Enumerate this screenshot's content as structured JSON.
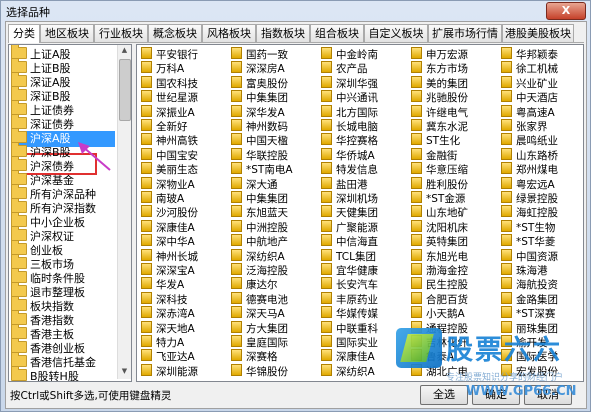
{
  "window": {
    "title": "选择品种",
    "close_label": "X"
  },
  "tabs": [
    "分类",
    "地区板块",
    "行业板块",
    "概念板块",
    "风格板块",
    "指数板块",
    "组合板块",
    "自定义板块",
    "扩展市场行情",
    "港股美股板块"
  ],
  "tree": [
    "上证A股",
    "上证B股",
    "深证A股",
    "深证B股",
    "上证债券",
    "深证债券",
    "沪深A股",
    "沪深B股",
    "沪深债券",
    "沪深基金",
    "所有沪深品种",
    "所有沪深指数",
    "中小企业板",
    "沪深权证",
    "创业板",
    "三板市场",
    "临时条件股",
    "退市整理板",
    "板块指数",
    "香港指数",
    "香港主板",
    "香港创业板",
    "香港信托基金",
    "B股转H股"
  ],
  "stocks": [
    [
      "平安银行",
      "万科A",
      "国农科技",
      "世纪星源",
      "深振业A",
      "全新好",
      "神州高铁",
      "中国宝安",
      "美丽生态",
      "深物业A",
      "南玻A",
      "沙河股份",
      "深康佳A",
      "深中华A",
      "神州长城",
      "深深宝A",
      "华发A",
      "深科技",
      "深赤湾A",
      "深天地A",
      "特力A",
      "飞亚达A",
      "深圳能源"
    ],
    [
      "国药一致",
      "深深房A",
      "富奥股份",
      "中集集团",
      "深华发A",
      "神州数码",
      "中国天楹",
      "华联控股",
      "*ST南电A",
      "深大通",
      "中集集团",
      "东旭蓝天",
      "中洲控股",
      "中航地产",
      "深纺织A",
      "泛海控股",
      "康达尔",
      "德赛电池",
      "深天马A",
      "方大集团",
      "皇庭国际",
      "深赛格",
      "华锦股份"
    ],
    [
      "中金岭南",
      "农产品",
      "深圳华强",
      "中兴通讯",
      "北方国际",
      "长城电脑",
      "华控赛格",
      "华侨城A",
      "特发信息",
      "盐田港",
      "深圳机场",
      "天健集团",
      "广聚能源",
      "中信海直",
      "TCL集团",
      "宜华健康",
      "长安汽车",
      "丰原药业",
      "华媒传媒",
      "中联重科",
      "国际实业",
      "深康佳A",
      "深纺织A"
    ],
    [
      "申万宏源",
      "东方市场",
      "美的集团",
      "兆驰股份",
      "许继电气",
      "冀东水泥",
      "ST生化",
      "金融街",
      "华意压缩",
      "胜利股份",
      "*ST金源",
      "山东地矿",
      "沈阳机床",
      "英特集团",
      "东旭光电",
      "渤海金控",
      "民生控股",
      "合肥百货",
      "小天鹅A",
      "通程控股",
      "吉林化纤",
      "鲁泰A",
      "湖北广电"
    ],
    [
      "华邦颖泰",
      "徐工机械",
      "兴业矿业",
      "中天酒店",
      "粤高速A",
      "张家界",
      "晨鸣纸业",
      "山东路桥",
      "郑州煤电",
      "粤宏远A",
      "绿景控股",
      "海虹控股",
      "*ST生物",
      "*ST华菱",
      "中国资源",
      "珠海港",
      "海航投资",
      "金路集团",
      "*ST深赛",
      "丽珠集团",
      "渝开发",
      "国际医学",
      "宏发股份"
    ]
  ],
  "status": {
    "hint": "按Ctrl或Shift多选,可使用键盘精灵",
    "select_all": "全选",
    "ok": "确定",
    "cancel": "取消"
  },
  "watermark": {
    "name": "股票六六",
    "sub": "专注股票知识分享的财经门户",
    "url": "WWW.GP66.CN"
  }
}
